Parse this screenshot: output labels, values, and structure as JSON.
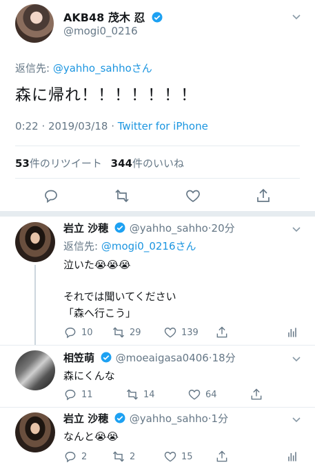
{
  "main_tweet": {
    "display_name": "AKB48 茂木 忍",
    "handle": "@mogi0_0216",
    "reply_prefix": "返信先: ",
    "reply_to": "@yahho_sahhoさん",
    "text": "森に帰れ！！！！！！！",
    "time": "0:22 · 2019/03/18 · ",
    "source": "Twitter for iPhone",
    "retweet_count": "53",
    "retweet_label": "件のリツイート",
    "like_count": "344",
    "like_label": "件のいいね"
  },
  "replies": [
    {
      "display_name": "岩立 沙穂",
      "handle": "@yahho_sahho",
      "time": "·20分",
      "reply_prefix": "返信先: ",
      "reply_to": "@mogi0_0216さん",
      "line1": "泣いた😭😭😭",
      "line2": "それでは聞いてください",
      "line3": "「森へ行こう」",
      "replies": "10",
      "retweets": "29",
      "likes": "139"
    },
    {
      "display_name": "相笠萌",
      "handle": "@moeaigasa0406",
      "time": "·18分",
      "text": "森にくんな",
      "replies": "11",
      "retweets": "14",
      "likes": "64"
    },
    {
      "display_name": "岩立 沙穂",
      "handle": "@yahho_sahho",
      "time": "·1分",
      "text": "なんと😭😭",
      "replies": "2",
      "retweets": "2",
      "likes": "15"
    }
  ],
  "colors": {
    "link": "#1b95e0",
    "muted": "#657786",
    "divider": "#e6ecf0",
    "thread_line": "#ccd6dd"
  }
}
